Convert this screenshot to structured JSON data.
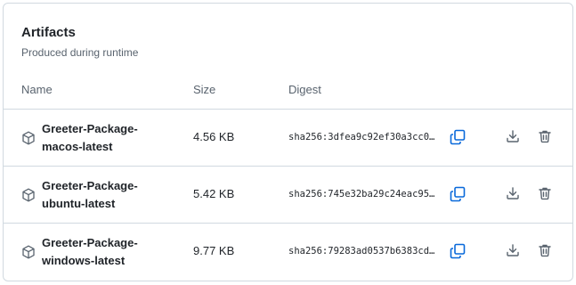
{
  "artifacts": {
    "title": "Artifacts",
    "subtitle": "Produced during runtime",
    "columns": {
      "name": "Name",
      "size": "Size",
      "digest": "Digest"
    },
    "rows": [
      {
        "name": "Greeter-Package-\nmacos-latest",
        "size": "4.56 KB",
        "digest": "sha256:3dfea9c92ef30a3cc0…"
      },
      {
        "name": "Greeter-Package-\nubuntu-latest",
        "size": "5.42 KB",
        "digest": "sha256:745e32ba29c24eac95…"
      },
      {
        "name": "Greeter-Package-\nwindows-latest",
        "size": "9.77 KB",
        "digest": "sha256:79283ad0537b6383cd…"
      }
    ]
  },
  "icons": {
    "package": "package-icon",
    "copy": "copy-icon",
    "download": "download-icon",
    "delete": "trash-icon"
  },
  "colors": {
    "accent": "#0969da",
    "muted": "#59636e",
    "border": "#d1d9e0"
  }
}
